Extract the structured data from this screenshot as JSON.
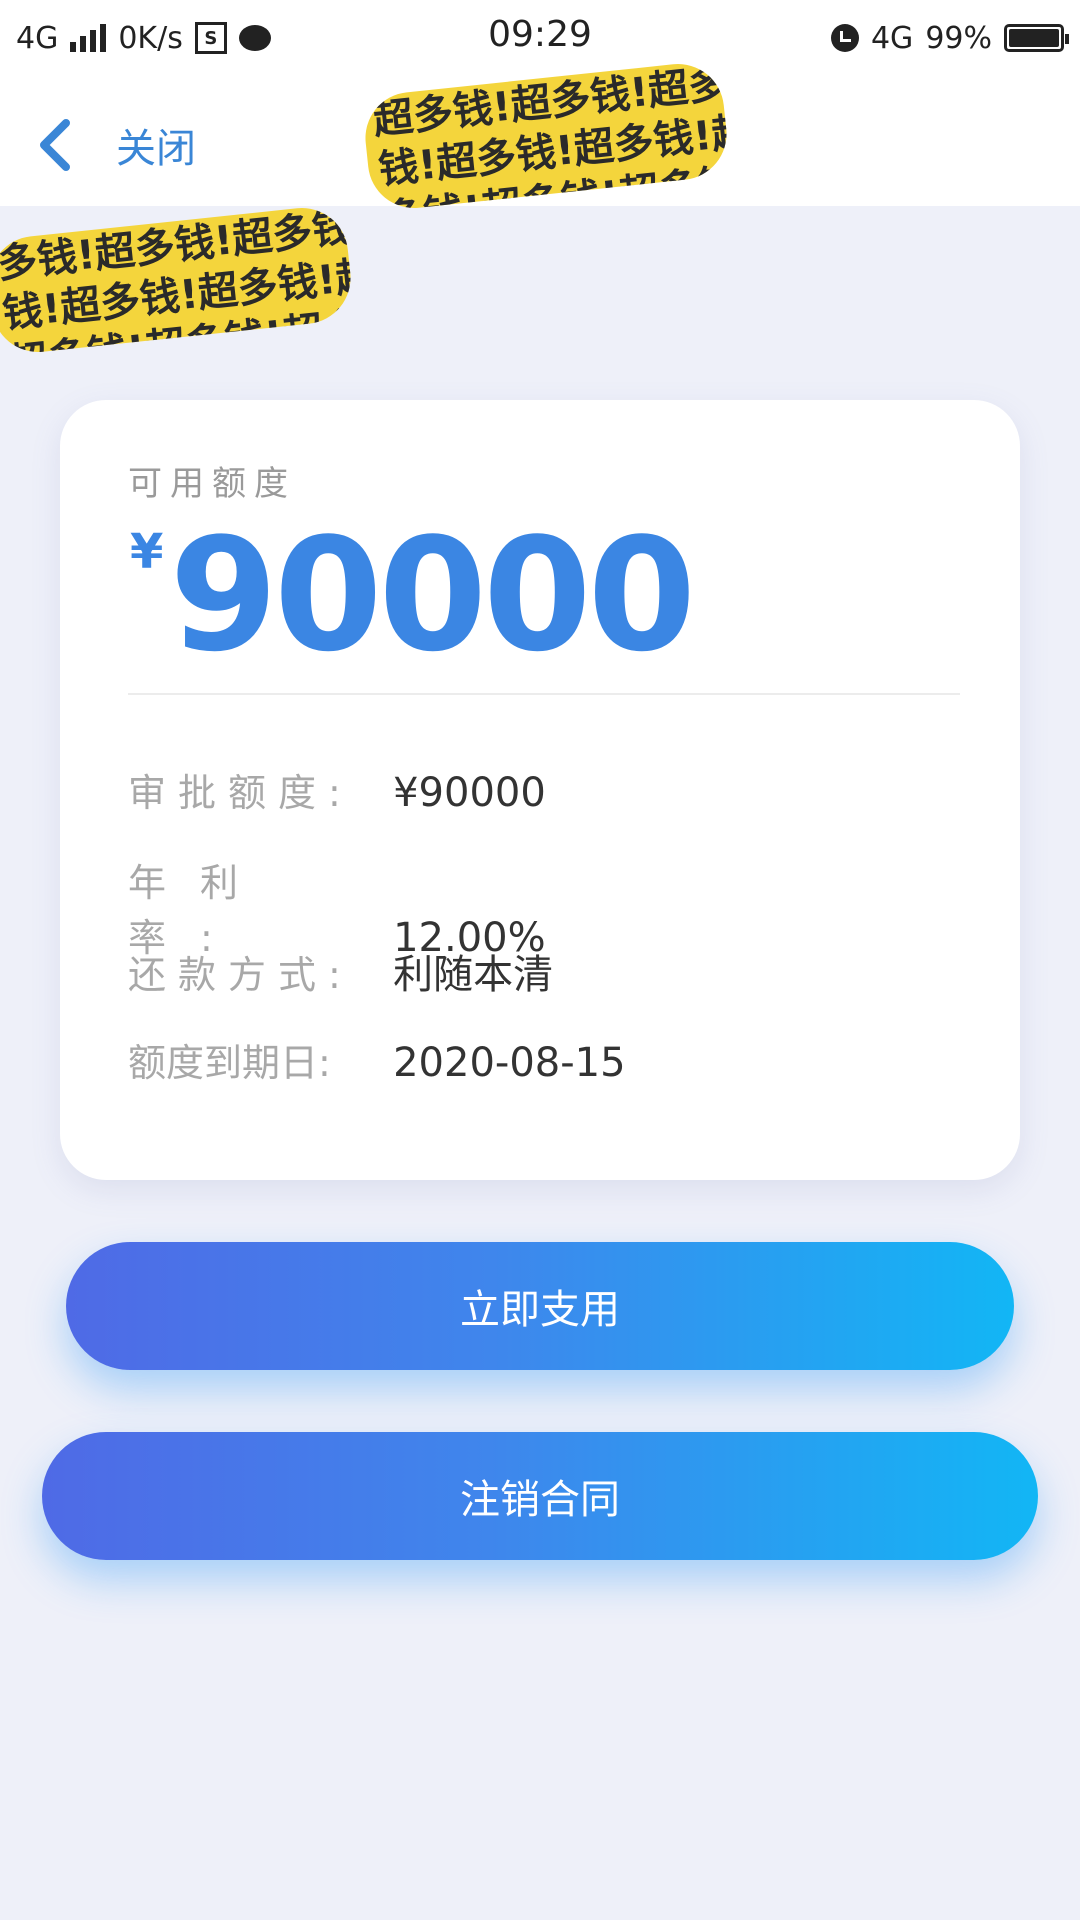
{
  "status_bar": {
    "network": "4G",
    "speed": "0K/s",
    "time": "09:29",
    "network_right": "4G",
    "battery": "99%",
    "battery_level": 0.99
  },
  "header": {
    "back_label": "关闭"
  },
  "stickers": {
    "sticker1_rows": [
      "超多钱!超多钱!超多钱!",
      "钱!超多钱!超多钱!超多",
      "多钱!超多钱!超多钱!超"
    ],
    "sticker2_rows": [
      "多钱!超多钱!超多钱!超",
      "钱!超多钱!超多钱!超多",
      "超多钱!超多钱!超多钱!"
    ]
  },
  "card": {
    "available_label": "可用额度",
    "currency_symbol": "¥",
    "available_amount": "90000",
    "rows": [
      {
        "key": "审批额度:",
        "value": "¥90000"
      },
      {
        "key": "年利率:",
        "value": "12.00%"
      },
      {
        "key": "还款方式:",
        "value": "利随本清"
      },
      {
        "key": "额度到期日:",
        "value": "2020-08-15"
      }
    ]
  },
  "buttons": {
    "use_now": "立即支用",
    "cancel_contract": "注销合同"
  },
  "colors": {
    "accent": "#3b86e3",
    "button_gradient_start": "#4f6ae6",
    "button_gradient_end": "#12b6f5",
    "sticker": "#f4d53c"
  }
}
